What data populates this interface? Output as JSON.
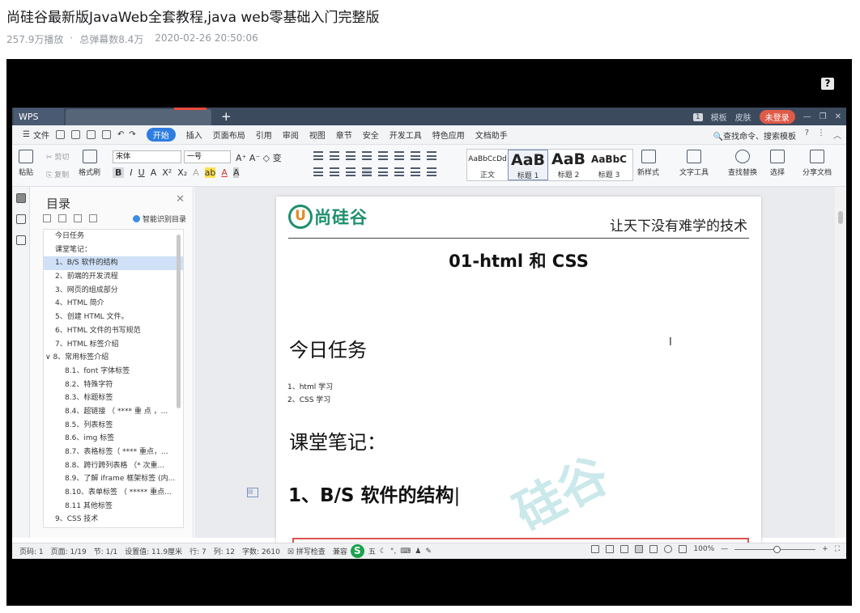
{
  "video": {
    "title": "尚硅谷最新版JavaWeb全套教程,java web零基础入门完整版",
    "views": "257.9万播放",
    "danmaku": "总弹幕数8.4万",
    "date": "2020-02-26 20:50:06",
    "help_glyph": "?"
  },
  "wps": {
    "app_tab": "WPS",
    "new_tab": "+",
    "page_indicator": "1",
    "template": "模板",
    "skin": "皮肤",
    "login": "未登录",
    "menu": {
      "file": "文件",
      "tabs": [
        "开始",
        "插入",
        "页面布局",
        "引用",
        "审阅",
        "视图",
        "章节",
        "安全",
        "开发工具",
        "特色应用",
        "文档助手"
      ],
      "search": "查找命令、搜索模板",
      "help": "?"
    },
    "ribbon": {
      "paste": "粘贴",
      "cut": "剪切",
      "copy": "复制",
      "format_painter": "格式刷",
      "font": "宋体",
      "size": "一号",
      "styles": [
        {
          "sample": "AaBbCcDd",
          "label": "正文"
        },
        {
          "sample": "AaB",
          "label": "标题 1"
        },
        {
          "sample": "AaB",
          "label": "标题 2"
        },
        {
          "sample": "AaBbC",
          "label": "标题 3"
        }
      ],
      "new_style": "新样式",
      "text_tools": "文字工具",
      "find_replace": "查找替换",
      "select": "选择",
      "share": "分享文档"
    },
    "toc": {
      "title": "目录",
      "smart": "智能识别目录",
      "items": [
        "今日任务",
        "课堂笔记：",
        "1、B/S 软件的结构",
        "2、前端的开发流程",
        "3、网页的组成部分",
        "4、HTML 简介",
        "5、创建 HTML 文件。",
        "6、HTML 文件的书写规范",
        "7、HTML 标签介绍",
        "8、常用标签介绍",
        "8.1、font 字体标签",
        "8.2、特殊字符",
        "8.3、标题标签",
        "8.4、超链接 （ **** 重 点 ，...",
        "8.5、列表标签",
        "8.6、img 标签",
        "8.7、表格标签（ **** 重点，...",
        "8.8、跨行跨列表格 （* 次重...",
        "8.9、了解 iframe 框架标签 (内...",
        "8.10、表单标签 （ ***** 重点...",
        "8.11 其他标签",
        "9、CSS 技术"
      ],
      "selected_index": 2
    },
    "doc": {
      "logo_text": "尚硅谷",
      "logo_u": "U",
      "slogan": "让天下没有难学的技术",
      "title": "01-html 和 CSS",
      "heading1": "今日任务",
      "line1": "1、html 学习",
      "line2": "2、CSS 学习",
      "heading2": "课堂笔记：",
      "heading3": "1、B/S  软件的结构",
      "watermark": "硅谷"
    },
    "status": {
      "page": "页码: 1",
      "pages": "页面: 1/19",
      "section": "节: 1/1",
      "setting": "设置值: 11.9厘米",
      "row": "行: 7",
      "col": "列: 12",
      "words": "字数: 2610",
      "spell": "拼写检查",
      "compat": "兼容",
      "ime": "五",
      "zoom": "100%"
    }
  }
}
